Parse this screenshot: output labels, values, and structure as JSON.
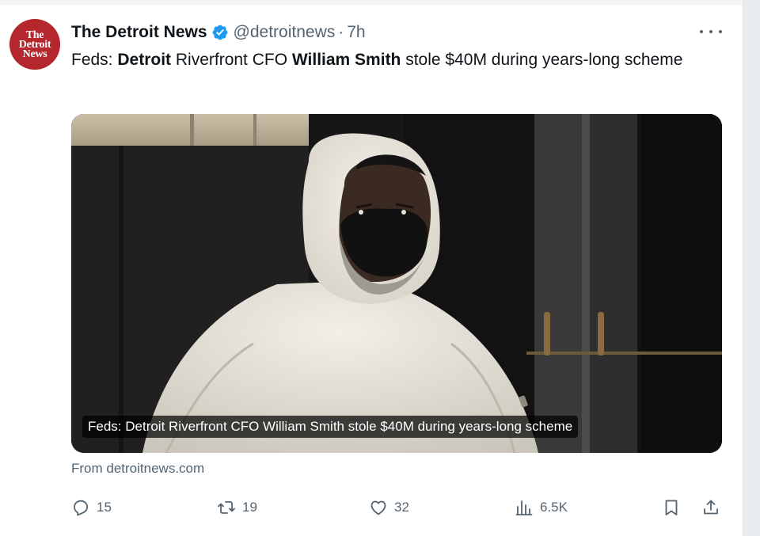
{
  "account": {
    "avatar_text": "The\nDetroit\nNews",
    "name": "The Detroit News",
    "handle": "@detroitnews",
    "separator": "·",
    "time": "7h"
  },
  "tweet": {
    "segments": [
      {
        "text": "Feds: ",
        "bold": false
      },
      {
        "text": "Detroit",
        "bold": true
      },
      {
        "text": " Riverfront CFO ",
        "bold": false
      },
      {
        "text": "William Smith",
        "bold": true
      },
      {
        "text": " stole $40M during years-long scheme",
        "bold": false
      }
    ]
  },
  "card": {
    "caption": "Feds: Detroit Riverfront CFO William Smith stole $40M during years-long scheme",
    "source": "From detroitnews.com"
  },
  "actions": {
    "replies": "15",
    "reposts": "19",
    "likes": "32",
    "views": "6.5K"
  },
  "icons": {
    "verified": "verified-badge-icon",
    "more": "more-icon",
    "reply": "reply-icon",
    "repost": "repost-icon",
    "like": "heart-icon",
    "views": "views-icon",
    "bookmark": "bookmark-icon",
    "share": "share-icon"
  },
  "colors": {
    "accent": "#1d9bf0",
    "text": "#0f1419",
    "muted": "#536471",
    "avatar_bg": "#b4272c"
  }
}
